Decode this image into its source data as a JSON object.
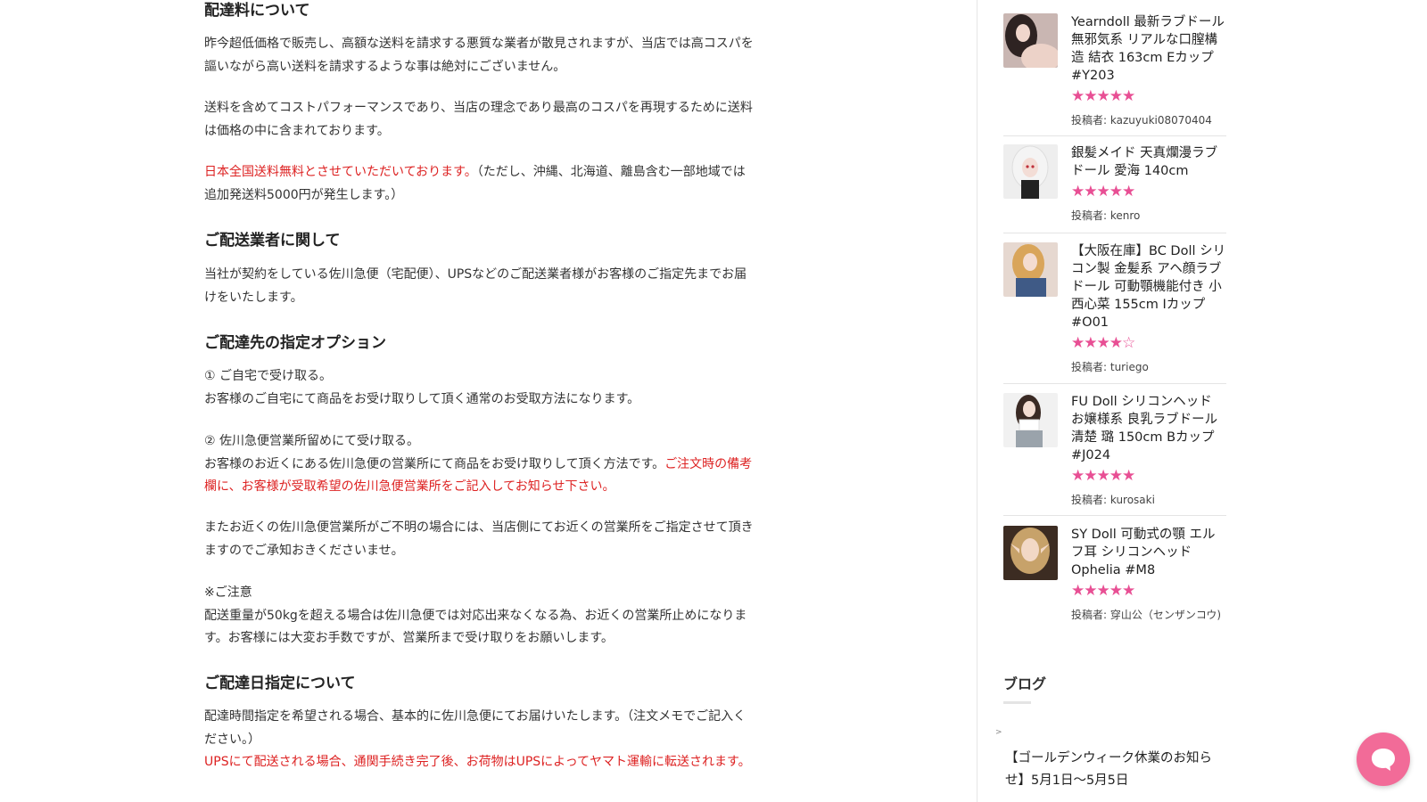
{
  "main": {
    "fee_heading": "配達料について",
    "fee_p1": "昨今超低価格で販売し、高額な送料を請求する悪質な業者が散見されますが、当店では高コスパを謳いながら高い送料を請求するような事は絶対にございません。",
    "fee_p2": "送料を含めてコストパフォーマンスであり、当店の理念であり最高のコスパを再現するために送料は価格の中に含まれております。",
    "fee_p3_red": "日本全国送料無料とさせていただいております。",
    "fee_p3_rest": "（ただし、沖縄、北海道、離島含む一部地域では追加発送料5000円が発生します。）",
    "carrier_heading": "ご配送業者に関して",
    "carrier_p": "当社が契約をしている佐川急便（宅配便）、UPSなどのご配送業者様がお客様のご指定先までお届けをいたします。",
    "options_heading": "ご配達先の指定オプション",
    "opt1_title": "① ご自宅で受け取る。",
    "opt1_desc": "お客様のご自宅にて商品をお受け取りして頂く通常のお受取方法になります。",
    "opt2_title": "② 佐川急便営業所留めにて受け取る。",
    "opt2_desc": "お客様のお近くにある佐川急便の営業所にて商品をお受け取りして頂く方法です。",
    "opt2_red": "ご注文時の備考欄に、お客様が受取希望の佐川急便営業所をご記入してお知らせ下さい。",
    "opt2_note": "またお近くの佐川急便営業所がご不明の場合には、当店側にてお近くの営業所をご指定させて頂きますのでご承知おきくださいませ。",
    "caution_title": "※ご注意",
    "caution_text": "配送重量が50kgを超える場合は佐川急便では対応出来なくなる為、お近くの営業所止めになります。お客様には大変お手数ですが、営業所まで受け取りをお願いします。",
    "date_heading": "ご配達日指定について",
    "date_p": "配達時間指定を希望される場合、基本的に佐川急便にてお届けいたします。（注文メモでご記入ください。）",
    "date_red": "UPSにて配送される場合、通関手続き完了後、お荷物はUPSによってヤマト運輸に転送されます。"
  },
  "sidebar": {
    "author_label": "投稿者: ",
    "reviews": [
      {
        "title": "Yearndoll 最新ラブドール 無邪気系 リアルな口膣構造 結衣 163cm Eカップ #Y203",
        "stars": "★★★★★",
        "rating": 5,
        "author": "kazuyuki08070404"
      },
      {
        "title": "銀髪メイド 天真爛漫ラブドール 愛海 140cm",
        "stars": "★★★★★",
        "rating": 5,
        "author": "kenro"
      },
      {
        "title": "【大阪在庫】BC Doll シリコン製 金髪系 アヘ顔ラブドール 可動顎機能付き 小西心菜 155cm Iカップ #O01",
        "stars": "★★★★☆",
        "rating": 4,
        "author": "turiego"
      },
      {
        "title": "FU Doll シリコンヘッド お嬢様系 良乳ラブドール 清楚 璐 150cm Bカップ #J024",
        "stars": "★★★★★",
        "rating": 5,
        "author": "kurosaki"
      },
      {
        "title": "SY Doll 可動式の顎 エルフ耳 シリコンヘッド Ophelia #M8",
        "stars": "★★★★★",
        "rating": 5,
        "author": "穿山公（センザンコウ)"
      }
    ],
    "blog_heading": "ブログ",
    "blog_bullet": ">",
    "blog_item": "【ゴールデンウィーク休業のお知らせ】5月1日〜5月5日"
  },
  "colors": {
    "accent_red": "#dd2222",
    "star_pink": "#e84f94",
    "chat_pink": "#f26b98"
  },
  "icons": {
    "chat": "chat-bubble-icon"
  }
}
